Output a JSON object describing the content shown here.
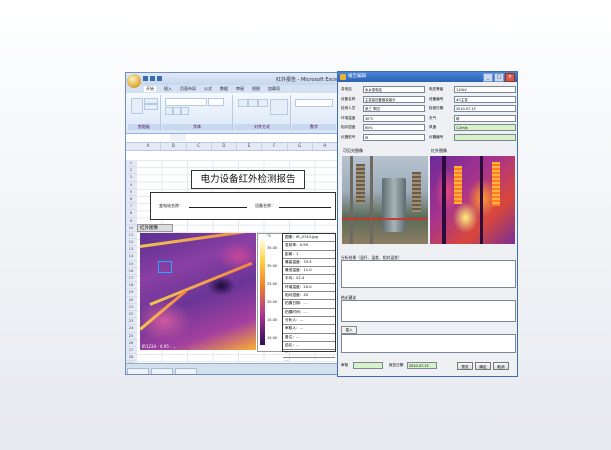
{
  "excel": {
    "window_title": "红外报告 - Microsoft Excel",
    "tabs": [
      "开始",
      "插入",
      "页面布局",
      "公式",
      "数据",
      "审阅",
      "视图",
      "加载项",
      "开发工具"
    ],
    "ribbon_groups": [
      "剪贴板",
      "字体",
      "对齐方式",
      "数字"
    ],
    "name_box": "",
    "columns": [
      "A",
      "B",
      "C",
      "D",
      "E",
      "F",
      "G",
      "H",
      "I"
    ],
    "rows": [
      "1",
      "2",
      "3",
      "4",
      "5",
      "6",
      "7",
      "8",
      "9",
      "10",
      "11",
      "12",
      "13",
      "14",
      "15",
      "16",
      "17",
      "18",
      "19",
      "20",
      "21",
      "22",
      "23",
      "24",
      "25",
      "26",
      "27",
      "28",
      "29",
      "30",
      "31",
      "32",
      "33",
      "34",
      "35",
      "36",
      "37",
      "38",
      "39",
      "40"
    ],
    "report_title": "电力设备红外检测报告",
    "substation_label": "变电站名称：",
    "device_label": "设备名称：",
    "section_label": "红外图像",
    "scale_ticks": [
      "35.00",
      "30.00",
      "25.00",
      "20.00",
      "15.00",
      "10.00"
    ],
    "scale_top": "°C",
    "image_stamp": "IR1234 · 0.95 · ...",
    "params": [
      "图像：IR_0743.jpg",
      "发射率：0.95",
      "距离：1",
      "最高温度：33.5",
      "最低温度：11.0",
      "平均：22.4",
      "环境温度：20.0",
      "相对湿度：45",
      "拍摄日期：...",
      "拍摄时间：...",
      "分析人：...",
      "审核人：...",
      "备注：...",
      "结论：...",
      "···",
      "···"
    ]
  },
  "dialog": {
    "title": "报告编辑",
    "fields": [
      {
        "k": "变电站",
        "v": "水乡变电站",
        "k2": "电压等级",
        "v2": "110kV"
      },
      {
        "k": "设备名称",
        "v": "主变高压套管及接头",
        "k2": "设备编号",
        "v2": "#1主变"
      },
      {
        "k": "检测人员",
        "v": "张三 李四",
        "k2": "检测日期",
        "v2": "2010-07-15"
      },
      {
        "k": "环境温度",
        "v": "30°C",
        "k2": "天气",
        "v2": "晴"
      },
      {
        "k": "相对湿度",
        "v": "60%",
        "k2": "风速",
        "v2": "1.2m/s"
      },
      {
        "k": "仪器型号",
        "v": "IR",
        "k2": "仪器编号",
        "v2": ""
      }
    ],
    "photo_label": "可见光图像",
    "ir_label": "红外图像",
    "analysis_caption": "分析结果（温升、温差、相对温差）",
    "conclusion_caption": "结论建议",
    "small_button": "插入",
    "bottom_k1": "审核",
    "bottom_f1": "",
    "bottom_k2": "报告日期",
    "bottom_f2": "2010-07-15",
    "btn_prev": "预览",
    "btn_ok": "确定",
    "btn_cancel": "取消"
  },
  "colors": {
    "titlebar": "#2b63b7",
    "field_green": "#d6f2c6"
  }
}
